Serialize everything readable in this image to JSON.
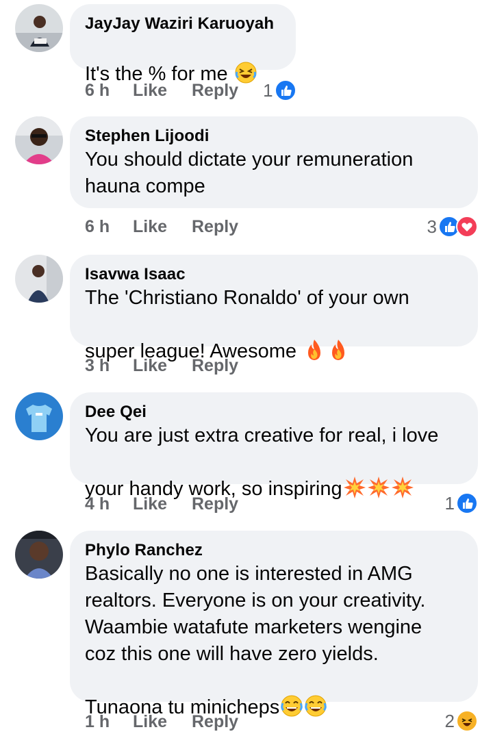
{
  "comments": [
    {
      "author": "JayJay Waziri Karuoyah",
      "text": "It's the % for me",
      "emoji": [
        "laughing-tears"
      ],
      "time": "6 h",
      "like": "Like",
      "reply": "Reply",
      "reaction_count": "1",
      "reactions": [
        "like"
      ]
    },
    {
      "author": "Stephen Lijoodi",
      "text": "You should dictate your remuneration\nhauna compe",
      "emoji": [],
      "time": "6 h",
      "like": "Like",
      "reply": "Reply",
      "reaction_count": "3",
      "reactions": [
        "like",
        "love"
      ]
    },
    {
      "author": "Isavwa Isaac",
      "text": "The 'Christiano Ronaldo' of your own\nsuper league! Awesome",
      "emoji": [
        "fire",
        "fire"
      ],
      "time": "3 h",
      "like": "Like",
      "reply": "Reply",
      "reaction_count": "",
      "reactions": []
    },
    {
      "author": "Dee Qei",
      "text": "You are just extra creative for real, i love\nyour handy work, so inspiring",
      "emoji": [
        "collision",
        "collision",
        "collision"
      ],
      "time": "4 h",
      "like": "Like",
      "reply": "Reply",
      "reaction_count": "1",
      "reactions": [
        "like"
      ]
    },
    {
      "author": "Phylo Ranchez",
      "text": "Basically no one is interested in AMG\nrealtors. Everyone is on your creativity.\nWaambie watafute marketers wengine\ncoz this one will have zero yields.\nTunaona tu minicheps",
      "emoji": [
        "joy",
        "joy"
      ],
      "time": "1 h",
      "like": "Like",
      "reply": "Reply",
      "reaction_count": "2",
      "reactions": [
        "haha"
      ]
    }
  ],
  "colors": {
    "bubble": "#f0f2f5",
    "meta": "#65676b",
    "like_blue": "#1877f2",
    "love_red": "#f33e58",
    "haha_yellow": "#f7b125"
  }
}
